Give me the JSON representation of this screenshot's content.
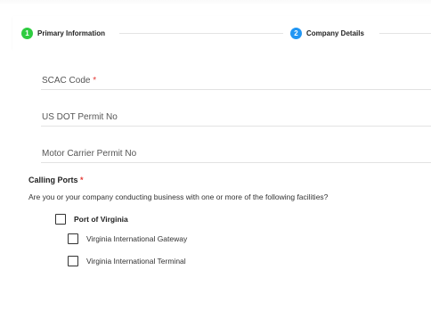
{
  "stepper": {
    "steps": [
      {
        "number": "1",
        "label": "Primary Information",
        "color": "#2ecc40",
        "status": "completed"
      },
      {
        "number": "2",
        "label": "Company Details",
        "color": "#2196f3",
        "status": "active"
      }
    ]
  },
  "form": {
    "fields": [
      {
        "label": "SCAC Code",
        "required_mark": " *",
        "value": ""
      },
      {
        "label": "US DOT Permit No",
        "value": ""
      },
      {
        "label": "Motor Carrier Permit No",
        "value": ""
      }
    ],
    "calling_ports": {
      "title": "Calling Ports",
      "required_mark": " *",
      "question": "Are you or your company conducting business with one or more of the following facilities?",
      "parent": {
        "label": "Port of Virginia",
        "checked": false
      },
      "children": [
        {
          "label": "Virginia International Gateway",
          "checked": false
        },
        {
          "label": "Virginia International Terminal",
          "checked": false
        }
      ]
    }
  },
  "colors": {
    "required": "#e53935",
    "step_complete": "#2ecc40",
    "step_active": "#2196f3"
  }
}
